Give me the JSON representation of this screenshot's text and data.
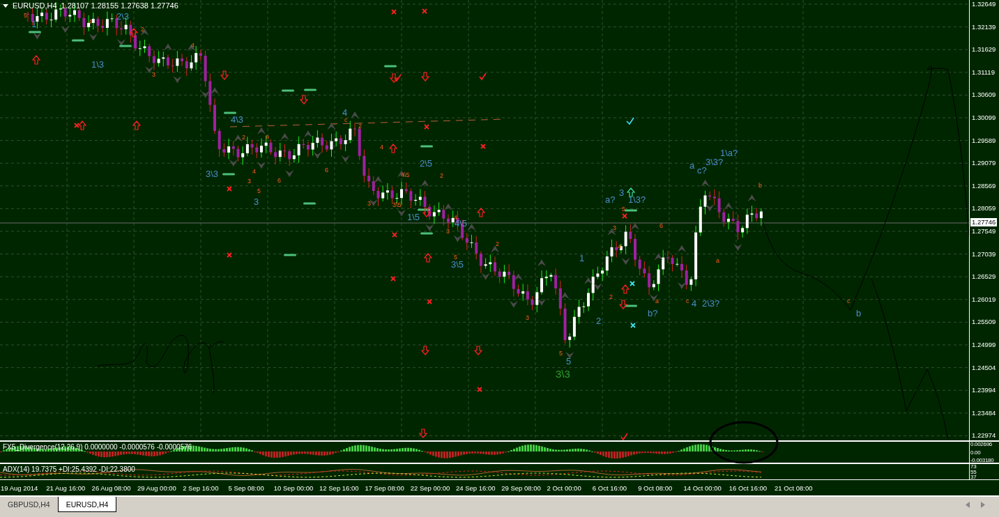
{
  "chart": {
    "symbol": "EURUSD,H4",
    "ohlc": "1.28107 1.28155 1.27638 1.27746",
    "current_price": "1.27746"
  },
  "wave_labels": [
    {
      "text": "1",
      "kind": "blue"
    },
    {
      "text": "2\\3",
      "kind": "blue"
    },
    {
      "text": "1\\3",
      "kind": "blue"
    },
    {
      "text": "4\\3",
      "kind": "blue"
    },
    {
      "text": "4",
      "kind": "blue"
    },
    {
      "text": "3\\3",
      "kind": "blue"
    },
    {
      "text": "3",
      "kind": "blue"
    },
    {
      "text": "2\\5",
      "kind": "blue"
    },
    {
      "text": "1\\5",
      "kind": "blue"
    },
    {
      "text": "4\\5",
      "kind": "blue"
    },
    {
      "text": "3\\5",
      "kind": "blue"
    },
    {
      "text": "1",
      "kind": "blue"
    },
    {
      "text": "2",
      "kind": "blue"
    },
    {
      "text": "a?",
      "kind": "blue"
    },
    {
      "text": "3",
      "kind": "blue"
    },
    {
      "text": "1\\3?",
      "kind": "blue"
    },
    {
      "text": "a",
      "kind": "blue"
    },
    {
      "text": "c?",
      "kind": "blue"
    },
    {
      "text": "3\\3?",
      "kind": "blue"
    },
    {
      "text": "1\\a?",
      "kind": "blue"
    },
    {
      "text": "b?",
      "kind": "blue"
    },
    {
      "text": "4",
      "kind": "blue"
    },
    {
      "text": "2\\3?",
      "kind": "blue"
    },
    {
      "text": "5",
      "kind": "blue"
    },
    {
      "text": "b",
      "kind": "blue"
    },
    {
      "text": "3\\3",
      "kind": "green"
    },
    {
      "text": "5",
      "kind": "orange"
    },
    {
      "text": "4",
      "kind": "orange"
    },
    {
      "text": "2",
      "kind": "orange"
    },
    {
      "text": "3",
      "kind": "orange"
    },
    {
      "text": "4",
      "kind": "orange"
    },
    {
      "text": "2",
      "kind": "orange"
    },
    {
      "text": "4",
      "kind": "orange"
    },
    {
      "text": "3",
      "kind": "orange"
    },
    {
      "text": "5",
      "kind": "orange"
    },
    {
      "text": "6",
      "kind": "orange"
    },
    {
      "text": "a",
      "kind": "orange"
    },
    {
      "text": "6",
      "kind": "orange"
    },
    {
      "text": "c",
      "kind": "orange"
    },
    {
      "text": "2",
      "kind": "orange"
    },
    {
      "text": "4",
      "kind": "orange"
    },
    {
      "text": "4\\5",
      "kind": "orange"
    },
    {
      "text": "3\\5",
      "kind": "orange"
    },
    {
      "text": "2",
      "kind": "orange"
    },
    {
      "text": "3",
      "kind": "orange"
    },
    {
      "text": "4",
      "kind": "orange"
    },
    {
      "text": "3",
      "kind": "orange"
    },
    {
      "text": "2",
      "kind": "orange"
    },
    {
      "text": "5",
      "kind": "orange"
    },
    {
      "text": "3",
      "kind": "orange"
    },
    {
      "text": "5",
      "kind": "orange"
    },
    {
      "text": "3",
      "kind": "orange"
    },
    {
      "text": "5",
      "kind": "orange"
    },
    {
      "text": "4",
      "kind": "orange"
    },
    {
      "text": "2",
      "kind": "orange"
    },
    {
      "text": "6",
      "kind": "orange"
    },
    {
      "text": "a",
      "kind": "orange"
    },
    {
      "text": "c",
      "kind": "orange"
    },
    {
      "text": "a",
      "kind": "orange"
    },
    {
      "text": "b",
      "kind": "orange"
    },
    {
      "text": "c",
      "kind": "orange"
    }
  ],
  "price_axis": [
    "1.32649",
    "1.32139",
    "1.31629",
    "1.31119",
    "1.30609",
    "1.30099",
    "1.29589",
    "1.29079",
    "1.28569",
    "1.28059",
    "1.27549",
    "1.27039",
    "1.26529",
    "1.26019",
    "1.25509",
    "1.24999",
    "1.24504",
    "1.23994",
    "1.23484",
    "1.22974"
  ],
  "divergence": {
    "title": "FX5_Divergence(12,26,9) 0.0000000 -0.0000576 -0.0000576",
    "axis": [
      "0.002696",
      "0.00",
      "-0.003180"
    ]
  },
  "adx": {
    "title": "ADX(14) 19.7375 +DI:25.4392 -DI:22.3800",
    "axis": [
      "73",
      "55",
      "37"
    ]
  },
  "time_axis": [
    "19 Aug 2014",
    "21 Aug 16:00",
    "26 Aug 08:00",
    "29 Aug 00:00",
    "2 Sep 16:00",
    "5 Sep 08:00",
    "10 Sep 00:00",
    "12 Sep 16:00",
    "17 Sep 08:00",
    "22 Sep 00:00",
    "24 Sep 16:00",
    "29 Sep 08:00",
    "2 Oct 00:00",
    "6 Oct 16:00",
    "9 Oct 08:00",
    "14 Oct 00:00",
    "16 Oct 16:00",
    "21 Oct 08:00"
  ],
  "tabs": [
    {
      "label": "GBPUSD,H4",
      "selected": false
    },
    {
      "label": "EURUSD,H4",
      "selected": true
    }
  ]
}
